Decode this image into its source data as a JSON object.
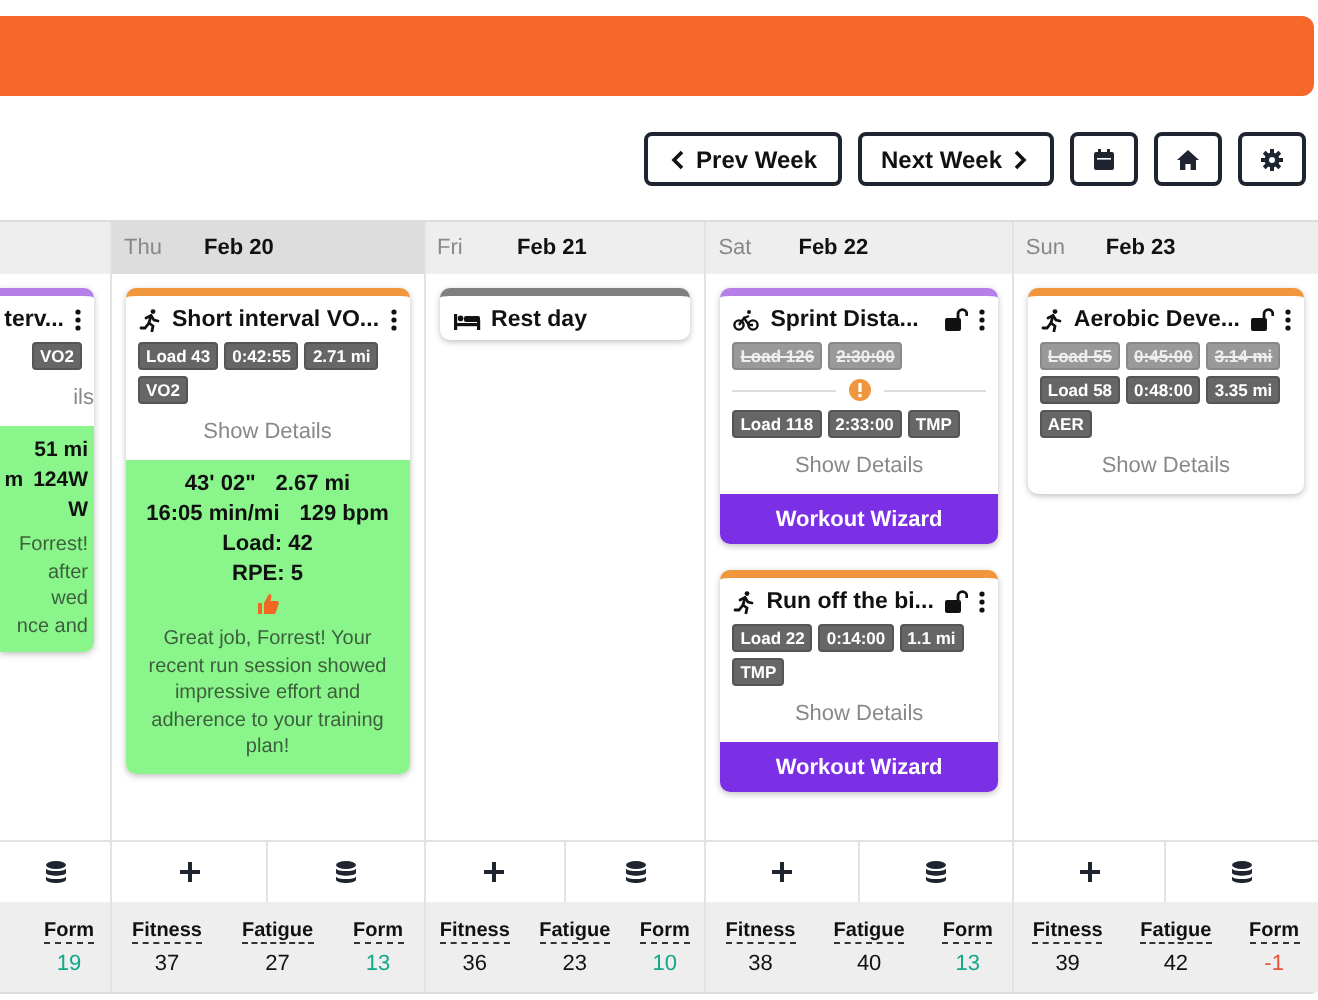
{
  "nav": {
    "buttons": [
      {
        "kind": "prev",
        "label": "Prev Week"
      },
      {
        "kind": "next",
        "label": "Next Week"
      },
      {
        "kind": "calendar"
      },
      {
        "kind": "home"
      },
      {
        "kind": "settings"
      }
    ]
  },
  "partial_day": {
    "workout": {
      "title": "terv...",
      "color": "#b57ee8",
      "tags": [
        {
          "text": "VO2",
          "struck": false
        }
      ],
      "details_label": "ils",
      "result": {
        "metrics": [
          [
            "51 mi"
          ],
          [
            "m",
            "124W"
          ],
          [
            "W"
          ]
        ],
        "feedback_lines": [
          "Forrest!",
          "after",
          "wed",
          "nce and"
        ]
      }
    },
    "actions": [
      {
        "kind": "data"
      }
    ],
    "stats": [
      {
        "label": "Form",
        "value": "19",
        "color": "#12a889"
      }
    ]
  },
  "days": [
    {
      "weekday": "Thu",
      "date": "Feb 20",
      "today": true,
      "workouts": [
        {
          "kind": "run",
          "title": "Short interval VO...",
          "color": "#f0963c",
          "tags": [
            {
              "text": "Load 43",
              "struck": false
            },
            {
              "text": "0:42:55",
              "struck": false
            },
            {
              "text": "2.71 mi",
              "struck": false
            },
            {
              "text": "VO2",
              "struck": false
            }
          ],
          "details_label": "Show Details",
          "result": {
            "metrics": [
              [
                "43' 02\"",
                "2.67 mi"
              ],
              [
                "16:05 min/mi",
                "129 bpm"
              ]
            ],
            "load": "Load: 42",
            "rpe": "RPE: 5",
            "liked": true,
            "feedback": "Great job, Forrest! Your recent run session showed impressive effort and adherence to your training plan!"
          }
        }
      ],
      "actions": [
        {
          "kind": "add"
        },
        {
          "kind": "data"
        }
      ],
      "stats": [
        {
          "label": "Fitness",
          "value": "37",
          "color": "#111111"
        },
        {
          "label": "Fatigue",
          "value": "27",
          "color": "#111111"
        },
        {
          "label": "Form",
          "value": "13",
          "color": "#12a889"
        }
      ]
    },
    {
      "weekday": "Fri",
      "date": "Feb 21",
      "today": false,
      "workouts": [
        {
          "kind": "rest",
          "title": "Rest day",
          "color": "#808080"
        }
      ],
      "actions": [
        {
          "kind": "add"
        },
        {
          "kind": "data"
        }
      ],
      "stats": [
        {
          "label": "Fitness",
          "value": "36",
          "color": "#111111"
        },
        {
          "label": "Fatigue",
          "value": "23",
          "color": "#111111"
        },
        {
          "label": "Form",
          "value": "10",
          "color": "#12a889"
        }
      ]
    },
    {
      "weekday": "Sat",
      "date": "Feb 22",
      "today": false,
      "workouts": [
        {
          "kind": "bike",
          "title": "Sprint Dista...",
          "color": "#b57ee8",
          "locked": false,
          "tags": [
            {
              "text": "Load 126",
              "struck": true
            },
            {
              "text": "2:30:00",
              "struck": true
            }
          ],
          "warning": true,
          "tags_after": [
            {
              "text": "Load 118",
              "struck": false
            },
            {
              "text": "2:33:00",
              "struck": false
            },
            {
              "text": "TMP",
              "struck": false
            }
          ],
          "details_label": "Show Details",
          "wizard": "Workout Wizard"
        },
        {
          "kind": "run",
          "title": "Run off the bi...",
          "color": "#f0963c",
          "locked": false,
          "tags": [
            {
              "text": "Load 22",
              "struck": false
            },
            {
              "text": "0:14:00",
              "struck": false
            },
            {
              "text": "1.1 mi",
              "struck": false
            },
            {
              "text": "TMP",
              "struck": false
            }
          ],
          "details_label": "Show Details",
          "wizard": "Workout Wizard"
        }
      ],
      "actions": [
        {
          "kind": "add"
        },
        {
          "kind": "data"
        }
      ],
      "stats": [
        {
          "label": "Fitness",
          "value": "38",
          "color": "#111111"
        },
        {
          "label": "Fatigue",
          "value": "40",
          "color": "#111111"
        },
        {
          "label": "Form",
          "value": "13",
          "color": "#12a889"
        }
      ]
    },
    {
      "weekday": "Sun",
      "date": "Feb 23",
      "today": false,
      "workouts": [
        {
          "kind": "run",
          "title": "Aerobic Deve...",
          "color": "#f0963c",
          "locked": false,
          "tags": [
            {
              "text": "Load 55",
              "struck": true
            },
            {
              "text": "0:45:00",
              "struck": true
            },
            {
              "text": "3.14 mi",
              "struck": true
            },
            {
              "text": "Load 58",
              "struck": false
            },
            {
              "text": "0:48:00",
              "struck": false
            },
            {
              "text": "3.35 mi",
              "struck": false
            },
            {
              "text": "AER",
              "struck": false
            }
          ],
          "details_label": "Show Details"
        }
      ],
      "actions": [
        {
          "kind": "add"
        },
        {
          "kind": "data"
        }
      ],
      "stats": [
        {
          "label": "Fitness",
          "value": "39",
          "color": "#111111"
        },
        {
          "label": "Fatigue",
          "value": "42",
          "color": "#111111"
        },
        {
          "label": "Form",
          "value": "-1",
          "color": "#e8533b"
        }
      ]
    }
  ]
}
